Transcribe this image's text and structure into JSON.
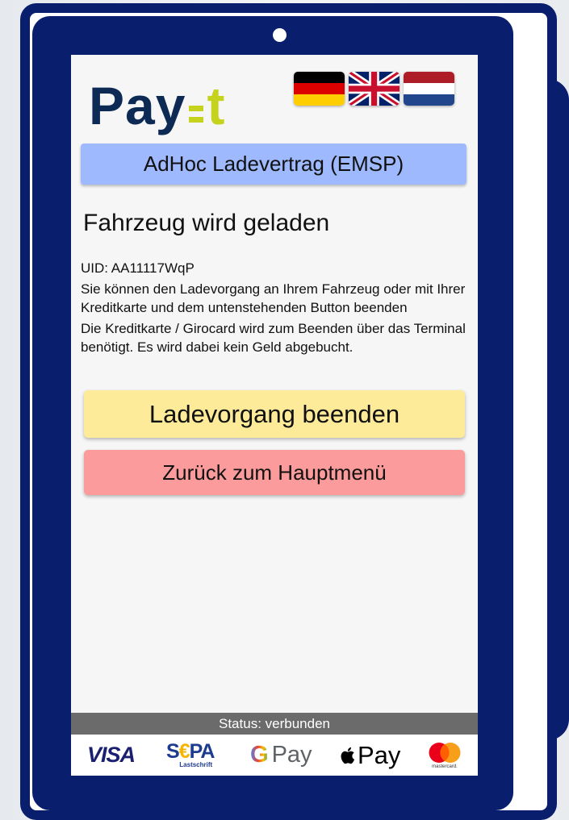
{
  "brand": {
    "logo_pay": "Pay",
    "logo_t": "t"
  },
  "languages": [
    {
      "name": "Deutsch",
      "icon": "german-flag-icon"
    },
    {
      "name": "English",
      "icon": "uk-flag-icon"
    },
    {
      "name": "Nederlands",
      "icon": "dutch-flag-icon"
    }
  ],
  "contract_button": "AdHoc Ladevertrag (EMSP)",
  "page_title": "Fahrzeug wird geladen",
  "uid_line": "UID: AA11117WqP",
  "info_text_1": "Sie können den Ladevorgang an Ihrem Fahrzeug oder mit Ihrer Kreditkarte und dem untenstehenden Button beenden",
  "info_text_2": "Die Kreditkarte / Girocard wird zum Beenden über das Terminal benötigt. Es wird dabei kein Geld abgebucht.",
  "buttons": {
    "stop_charging": "Ladevorgang beenden",
    "back_to_menu": "Zurück zum Hauptmenü"
  },
  "status_text": "Status: verbunden",
  "payment_methods": {
    "visa": "VISA",
    "sepa_main_s": "S",
    "sepa_main_e": "€",
    "sepa_main_pa": "PA",
    "sepa_sub": "Lastschrift",
    "gpay_g": "G",
    "gpay_text": "Pay",
    "applepay_text": "Pay",
    "mastercard_sub": "mastercard."
  },
  "colors": {
    "device_frame": "#0a1e6e",
    "emsp_button": "#9fb9ff",
    "stop_button": "#fdeb99",
    "back_button": "#fb9b9b",
    "status_bar": "#6b6b6b",
    "logo_navy": "#0d2a55",
    "logo_lime": "#c6d31e"
  }
}
